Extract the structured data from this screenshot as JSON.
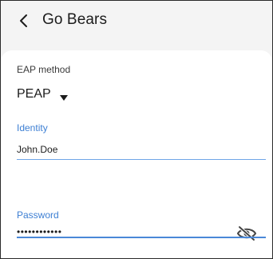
{
  "header": {
    "title": "Go Bears",
    "back_icon": "chevron-left-icon"
  },
  "form": {
    "eap_method": {
      "label": "EAP method",
      "value": "PEAP",
      "caret_icon": "caret-down-icon"
    },
    "identity": {
      "label": "Identity",
      "value": "John.Doe"
    },
    "password": {
      "label": "Password",
      "value": "••••••••••••",
      "visibility_icon": "eye-off-icon"
    }
  },
  "colors": {
    "accent": "#3d7fd3",
    "header_bg": "#f4f4f4",
    "card_bg": "#ffffff",
    "text": "#1c1c1c"
  }
}
